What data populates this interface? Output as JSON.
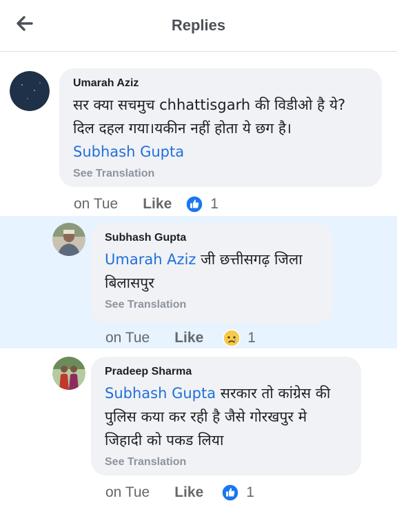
{
  "header": {
    "title": "Replies"
  },
  "comments": [
    {
      "author": "Umarah Aziz",
      "text_line1": "सर क्या सचमुच chhattisgarh की विडीओ है ये?",
      "text_line2": "दिल दहल गया।यकीन नहीं होता ये छग है।",
      "mention": "Subhash Gupta",
      "see_translation": "See Translation",
      "time": "on Tue",
      "like": "Like",
      "reaction_icon": "like-reaction-icon",
      "reaction_count": "1"
    },
    {
      "author": "Subhash Gupta",
      "mention": "Umarah Aziz",
      "text_line1": " जी छत्तीसगढ़ जिला",
      "text_line2": "बिलासपुर",
      "see_translation": "See Translation",
      "time": "on Tue",
      "like": "Like",
      "reaction_icon": "sad-reaction-icon",
      "reaction_count": "1"
    },
    {
      "author": "Pradeep Sharma",
      "mention": "Subhash Gupta",
      "text_line1": " सरकार तो कांग्रेस की",
      "text_line2": "पुलिस कया कर रही है जैसे गोरखपुर मे",
      "text_line3": "जिहादी को पकड लिया",
      "see_translation": "See Translation",
      "time": "on Tue",
      "like": "Like",
      "reaction_icon": "like-reaction-icon",
      "reaction_count": "1"
    }
  ],
  "colors": {
    "accent": "#216fdb",
    "highlight": "#e7f3ff",
    "bubble": "#f0f2f5"
  }
}
